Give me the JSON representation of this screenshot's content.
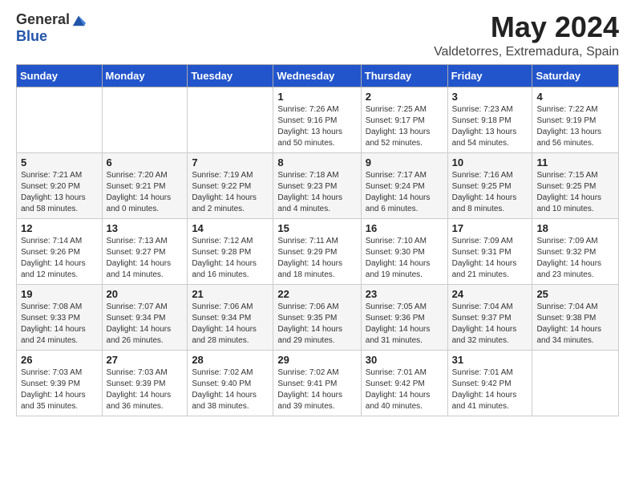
{
  "header": {
    "logo_general": "General",
    "logo_blue": "Blue",
    "month": "May 2024",
    "location": "Valdetorres, Extremadura, Spain"
  },
  "days_of_week": [
    "Sunday",
    "Monday",
    "Tuesday",
    "Wednesday",
    "Thursday",
    "Friday",
    "Saturday"
  ],
  "weeks": [
    [
      {
        "day": "",
        "info": ""
      },
      {
        "day": "",
        "info": ""
      },
      {
        "day": "",
        "info": ""
      },
      {
        "day": "1",
        "info": "Sunrise: 7:26 AM\nSunset: 9:16 PM\nDaylight: 13 hours\nand 50 minutes."
      },
      {
        "day": "2",
        "info": "Sunrise: 7:25 AM\nSunset: 9:17 PM\nDaylight: 13 hours\nand 52 minutes."
      },
      {
        "day": "3",
        "info": "Sunrise: 7:23 AM\nSunset: 9:18 PM\nDaylight: 13 hours\nand 54 minutes."
      },
      {
        "day": "4",
        "info": "Sunrise: 7:22 AM\nSunset: 9:19 PM\nDaylight: 13 hours\nand 56 minutes."
      }
    ],
    [
      {
        "day": "5",
        "info": "Sunrise: 7:21 AM\nSunset: 9:20 PM\nDaylight: 13 hours\nand 58 minutes."
      },
      {
        "day": "6",
        "info": "Sunrise: 7:20 AM\nSunset: 9:21 PM\nDaylight: 14 hours\nand 0 minutes."
      },
      {
        "day": "7",
        "info": "Sunrise: 7:19 AM\nSunset: 9:22 PM\nDaylight: 14 hours\nand 2 minutes."
      },
      {
        "day": "8",
        "info": "Sunrise: 7:18 AM\nSunset: 9:23 PM\nDaylight: 14 hours\nand 4 minutes."
      },
      {
        "day": "9",
        "info": "Sunrise: 7:17 AM\nSunset: 9:24 PM\nDaylight: 14 hours\nand 6 minutes."
      },
      {
        "day": "10",
        "info": "Sunrise: 7:16 AM\nSunset: 9:25 PM\nDaylight: 14 hours\nand 8 minutes."
      },
      {
        "day": "11",
        "info": "Sunrise: 7:15 AM\nSunset: 9:25 PM\nDaylight: 14 hours\nand 10 minutes."
      }
    ],
    [
      {
        "day": "12",
        "info": "Sunrise: 7:14 AM\nSunset: 9:26 PM\nDaylight: 14 hours\nand 12 minutes."
      },
      {
        "day": "13",
        "info": "Sunrise: 7:13 AM\nSunset: 9:27 PM\nDaylight: 14 hours\nand 14 minutes."
      },
      {
        "day": "14",
        "info": "Sunrise: 7:12 AM\nSunset: 9:28 PM\nDaylight: 14 hours\nand 16 minutes."
      },
      {
        "day": "15",
        "info": "Sunrise: 7:11 AM\nSunset: 9:29 PM\nDaylight: 14 hours\nand 18 minutes."
      },
      {
        "day": "16",
        "info": "Sunrise: 7:10 AM\nSunset: 9:30 PM\nDaylight: 14 hours\nand 19 minutes."
      },
      {
        "day": "17",
        "info": "Sunrise: 7:09 AM\nSunset: 9:31 PM\nDaylight: 14 hours\nand 21 minutes."
      },
      {
        "day": "18",
        "info": "Sunrise: 7:09 AM\nSunset: 9:32 PM\nDaylight: 14 hours\nand 23 minutes."
      }
    ],
    [
      {
        "day": "19",
        "info": "Sunrise: 7:08 AM\nSunset: 9:33 PM\nDaylight: 14 hours\nand 24 minutes."
      },
      {
        "day": "20",
        "info": "Sunrise: 7:07 AM\nSunset: 9:34 PM\nDaylight: 14 hours\nand 26 minutes."
      },
      {
        "day": "21",
        "info": "Sunrise: 7:06 AM\nSunset: 9:34 PM\nDaylight: 14 hours\nand 28 minutes."
      },
      {
        "day": "22",
        "info": "Sunrise: 7:06 AM\nSunset: 9:35 PM\nDaylight: 14 hours\nand 29 minutes."
      },
      {
        "day": "23",
        "info": "Sunrise: 7:05 AM\nSunset: 9:36 PM\nDaylight: 14 hours\nand 31 minutes."
      },
      {
        "day": "24",
        "info": "Sunrise: 7:04 AM\nSunset: 9:37 PM\nDaylight: 14 hours\nand 32 minutes."
      },
      {
        "day": "25",
        "info": "Sunrise: 7:04 AM\nSunset: 9:38 PM\nDaylight: 14 hours\nand 34 minutes."
      }
    ],
    [
      {
        "day": "26",
        "info": "Sunrise: 7:03 AM\nSunset: 9:39 PM\nDaylight: 14 hours\nand 35 minutes."
      },
      {
        "day": "27",
        "info": "Sunrise: 7:03 AM\nSunset: 9:39 PM\nDaylight: 14 hours\nand 36 minutes."
      },
      {
        "day": "28",
        "info": "Sunrise: 7:02 AM\nSunset: 9:40 PM\nDaylight: 14 hours\nand 38 minutes."
      },
      {
        "day": "29",
        "info": "Sunrise: 7:02 AM\nSunset: 9:41 PM\nDaylight: 14 hours\nand 39 minutes."
      },
      {
        "day": "30",
        "info": "Sunrise: 7:01 AM\nSunset: 9:42 PM\nDaylight: 14 hours\nand 40 minutes."
      },
      {
        "day": "31",
        "info": "Sunrise: 7:01 AM\nSunset: 9:42 PM\nDaylight: 14 hours\nand 41 minutes."
      },
      {
        "day": "",
        "info": ""
      }
    ]
  ]
}
